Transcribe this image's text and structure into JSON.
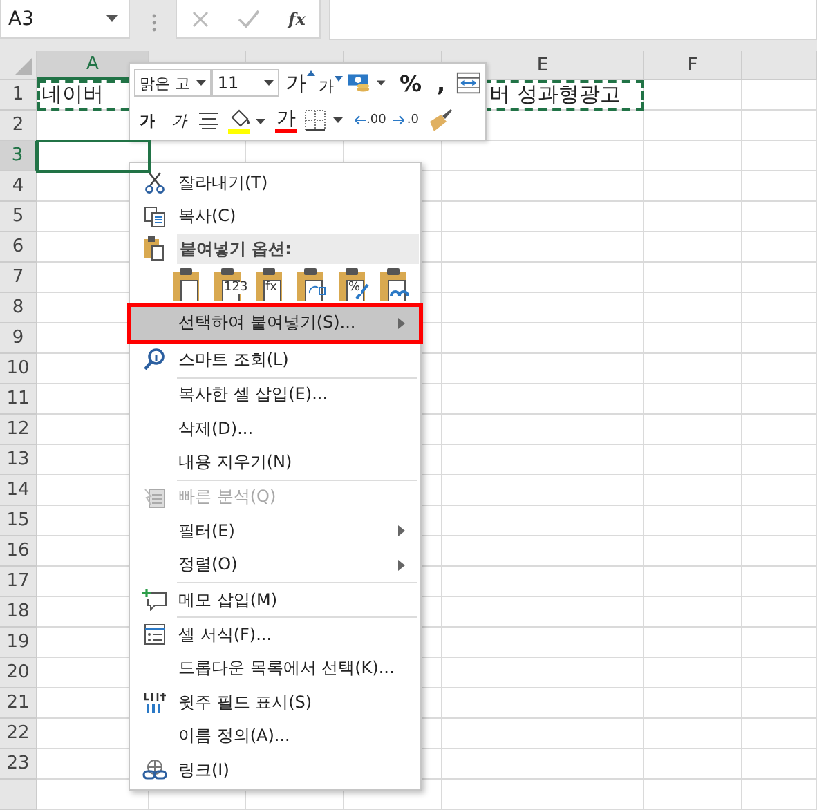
{
  "name_box": "A3",
  "formula_bar": {
    "function_label": "fx"
  },
  "columns": [
    {
      "label": "A"
    },
    {},
    {},
    {},
    {
      "label": "E"
    },
    {
      "label": "F"
    }
  ],
  "rows": [
    {
      "label": "1",
      "selected": false,
      "cells": [
        "네이버",
        "",
        "",
        "",
        "버 성과형광고",
        ""
      ]
    },
    {
      "label": "2",
      "selected": false,
      "cells": []
    },
    {
      "label": "3",
      "selected": true,
      "cells": []
    },
    {
      "label": "4",
      "selected": false,
      "cells": []
    },
    {
      "label": "5",
      "selected": false,
      "cells": []
    },
    {
      "label": "6",
      "selected": false,
      "cells": []
    },
    {
      "label": "7",
      "selected": false,
      "cells": []
    },
    {
      "label": "8",
      "selected": false,
      "cells": []
    },
    {
      "label": "9",
      "selected": false,
      "cells": []
    },
    {
      "label": "10",
      "selected": false,
      "cells": []
    },
    {
      "label": "11",
      "selected": false,
      "cells": []
    },
    {
      "label": "12",
      "selected": false,
      "cells": []
    },
    {
      "label": "13",
      "selected": false,
      "cells": []
    },
    {
      "label": "14",
      "selected": false,
      "cells": []
    },
    {
      "label": "15",
      "selected": false,
      "cells": []
    },
    {
      "label": "16",
      "selected": false,
      "cells": []
    },
    {
      "label": "17",
      "selected": false,
      "cells": []
    },
    {
      "label": "18",
      "selected": false,
      "cells": []
    },
    {
      "label": "19",
      "selected": false,
      "cells": []
    },
    {
      "label": "20",
      "selected": false,
      "cells": []
    },
    {
      "label": "21",
      "selected": false,
      "cells": []
    },
    {
      "label": "22",
      "selected": false,
      "cells": []
    },
    {
      "label": "23",
      "selected": false,
      "cells": []
    }
  ],
  "mini_toolbar": {
    "font": "맑은 고",
    "size": "11",
    "row1": [
      {
        "kind": "grow",
        "label": "가"
      },
      {
        "kind": "shrink",
        "label": "가"
      },
      {
        "kind": "accounting"
      },
      {
        "kind": "text",
        "label": "%"
      },
      {
        "kind": "text",
        "label": ","
      },
      {
        "kind": "merge"
      }
    ],
    "row2": [
      {
        "kind": "bold",
        "label": "가"
      },
      {
        "kind": "italic",
        "label": "가"
      },
      {
        "kind": "align"
      },
      {
        "kind": "fill",
        "color": "#ffff00"
      },
      {
        "kind": "fontcolor",
        "label": "가",
        "color": "#ff0000"
      },
      {
        "kind": "border"
      },
      {
        "kind": "decimal_up",
        "label": ".00"
      },
      {
        "kind": "decimal_down",
        "label": ".0"
      },
      {
        "kind": "painter"
      }
    ]
  },
  "context_menu": [
    {
      "kind": "item",
      "label": "잘라내기(T)",
      "disabled": false,
      "selected": false,
      "submenu": false
    },
    {
      "kind": "item",
      "label": "복사(C)",
      "disabled": false,
      "selected": false,
      "submenu": false
    },
    {
      "kind": "header",
      "label": "붙여넣기 옵션:"
    },
    {
      "kind": "paste",
      "options": [
        {
          "kind": "all"
        },
        {
          "kind": "values",
          "mark": "123"
        },
        {
          "kind": "formulas",
          "mark": "fx"
        },
        {
          "kind": "transpose"
        },
        {
          "kind": "formatting",
          "mark": "%"
        },
        {
          "kind": "link"
        }
      ]
    },
    {
      "kind": "item",
      "label": "선택하여 붙여넣기(S)...",
      "disabled": false,
      "selected": true,
      "submenu": true,
      "annotated": true
    },
    {
      "kind": "item",
      "label": "스마트 조회(L)",
      "disabled": false,
      "selected": false,
      "submenu": false
    },
    {
      "kind": "separator"
    },
    {
      "kind": "item",
      "label": "복사한 셀 삽입(E)...",
      "disabled": false,
      "selected": false,
      "submenu": false
    },
    {
      "kind": "item",
      "label": "삭제(D)...",
      "disabled": false,
      "selected": false,
      "submenu": false
    },
    {
      "kind": "item",
      "label": "내용 지우기(N)",
      "disabled": false,
      "selected": false,
      "submenu": false
    },
    {
      "kind": "separator"
    },
    {
      "kind": "item",
      "label": "빠른 분석(Q)",
      "disabled": true,
      "selected": false,
      "submenu": false
    },
    {
      "kind": "item",
      "label": "필터(E)",
      "disabled": false,
      "selected": false,
      "submenu": true
    },
    {
      "kind": "item",
      "label": "정렬(O)",
      "disabled": false,
      "selected": false,
      "submenu": true
    },
    {
      "kind": "separator"
    },
    {
      "kind": "item",
      "label": "메모 삽입(M)",
      "disabled": false,
      "selected": false,
      "submenu": false
    },
    {
      "kind": "separator"
    },
    {
      "kind": "item",
      "label": "셀 서식(F)...",
      "disabled": false,
      "selected": false,
      "submenu": false
    },
    {
      "kind": "item",
      "label": "드롭다운 목록에서 선택(K)...",
      "disabled": false,
      "selected": false,
      "submenu": false
    },
    {
      "kind": "item",
      "label": "윗주 필드 표시(S)",
      "disabled": false,
      "selected": false,
      "submenu": false
    },
    {
      "kind": "item",
      "label": "이름 정의(A)...",
      "disabled": false,
      "selected": false,
      "submenu": false
    },
    {
      "kind": "item",
      "label": "링크(I)",
      "disabled": false,
      "selected": false,
      "submenu": false
    }
  ]
}
